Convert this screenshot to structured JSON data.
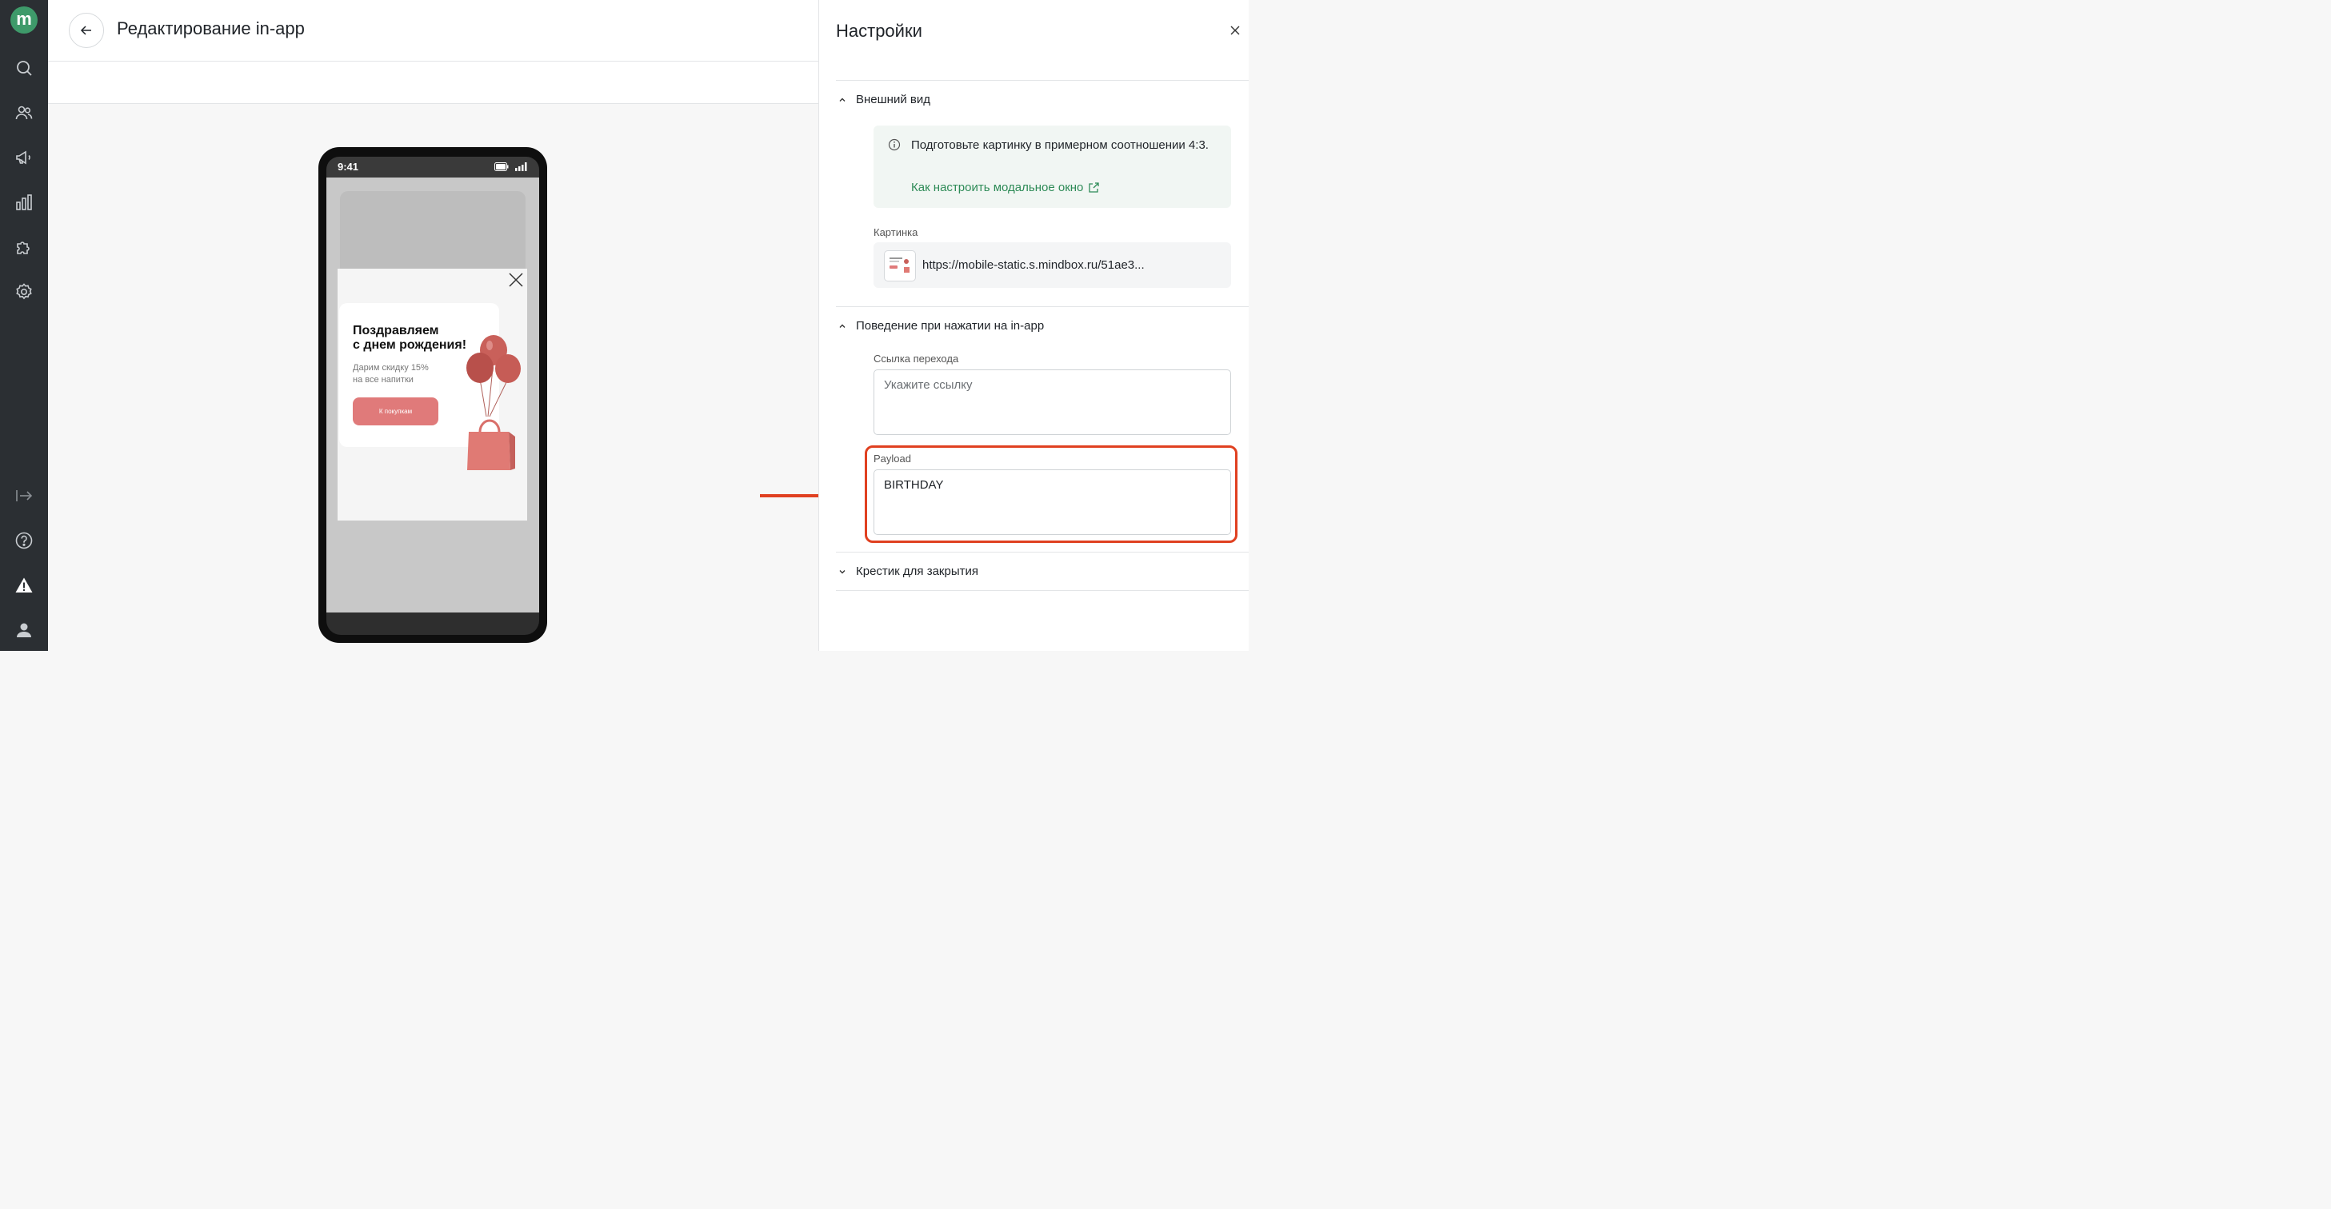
{
  "app": {
    "logo_letter": "m",
    "brand_color": "#3e9a6a"
  },
  "sidebar": {
    "items": [
      {
        "icon": "search-icon"
      },
      {
        "icon": "users-icon"
      },
      {
        "icon": "megaphone-icon"
      },
      {
        "icon": "analytics-icon"
      },
      {
        "icon": "puzzle-icon"
      },
      {
        "icon": "gear-icon"
      },
      {
        "icon": "expand-icon"
      },
      {
        "icon": "help-icon"
      },
      {
        "icon": "warning-icon"
      },
      {
        "icon": "user-icon"
      }
    ]
  },
  "header": {
    "title": "Редактирование in-app"
  },
  "phone": {
    "time": "9:41",
    "promo": {
      "title": "Поздравляем\nс днем рождения!",
      "text": "Дарим скидку 15%\nна все напитки",
      "button": "К покупкам",
      "button_color": "#e07a7a"
    }
  },
  "settings": {
    "title": "Настройки",
    "appearance": {
      "heading": "Внешний вид",
      "info_text": "Подготовьте картинку в примерном соотношении 4:3.",
      "info_link": "Как настроить модальное окно",
      "image_label": "Картинка",
      "image_url": "https://mobile-static.s.mindbox.ru/51ae3..."
    },
    "behavior": {
      "heading": "Поведение при нажатии на in-app",
      "link_label": "Ссылка перехода",
      "link_placeholder": "Укажите ссылку",
      "payload_label": "Payload",
      "payload_value": "BIRTHDAY"
    },
    "close_cross": {
      "heading": "Крестик для закрытия"
    }
  },
  "annotation": {
    "color": "#e04020"
  }
}
